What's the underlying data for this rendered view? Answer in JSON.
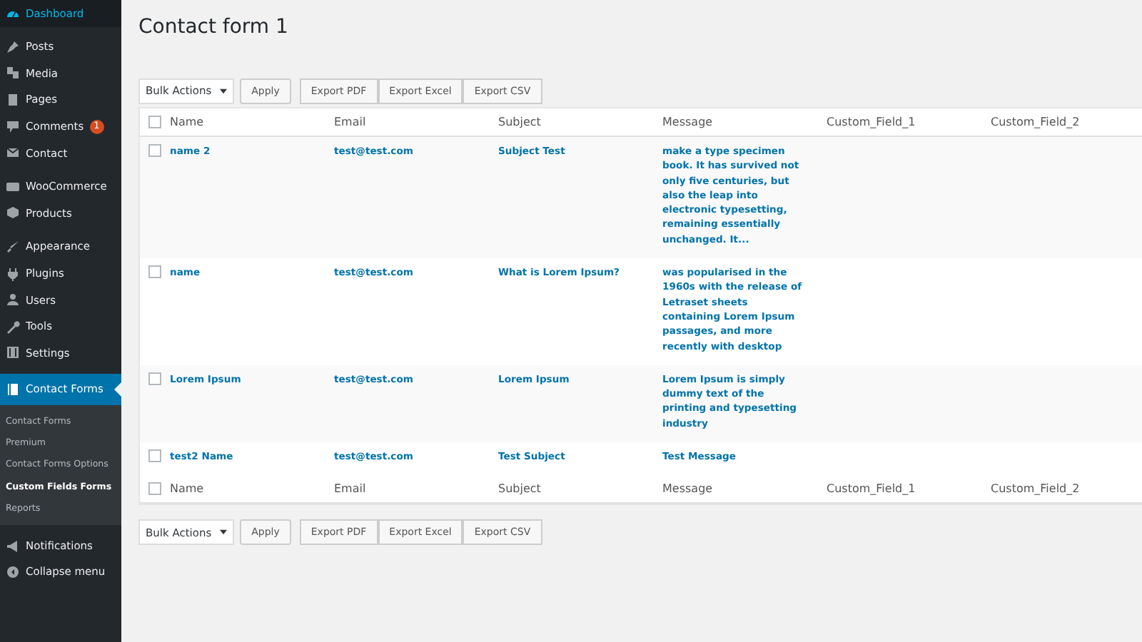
{
  "sidebar": {
    "groups": [
      [
        {
          "label": "Dashboard",
          "selected": false,
          "highlighted": true
        }
      ],
      [
        {
          "label": "Posts",
          "selected": false,
          "highlighted": false
        },
        {
          "label": "Media",
          "selected": false,
          "highlighted": false
        },
        {
          "label": "Pages",
          "selected": false,
          "highlighted": false
        },
        {
          "label": "Comments",
          "selected": false,
          "highlighted": false,
          "badge": "1"
        },
        {
          "label": "Contact",
          "selected": false,
          "highlighted": false
        }
      ],
      [
        {
          "label": "WooCommerce",
          "selected": false,
          "highlighted": false
        },
        {
          "label": "Products",
          "selected": false,
          "highlighted": false
        }
      ],
      [
        {
          "label": "Appearance",
          "selected": false,
          "highlighted": false
        },
        {
          "label": "Plugins",
          "selected": false,
          "highlighted": false
        },
        {
          "label": "Users",
          "selected": false,
          "highlighted": false
        },
        {
          "label": "Tools",
          "selected": false,
          "highlighted": false
        },
        {
          "label": "Settings",
          "selected": false,
          "highlighted": false
        }
      ],
      [
        {
          "label": "Contact Forms",
          "selected": true,
          "highlighted": false,
          "children": [
            {
              "label": "Contact Forms",
              "selected": false
            },
            {
              "label": "Premium",
              "selected": false
            },
            {
              "label": "Contact Forms Options",
              "selected": false
            },
            {
              "label": "Custom Fields Forms",
              "selected": true
            },
            {
              "label": "Reports",
              "selected": false
            }
          ]
        }
      ],
      [
        {
          "label": "Notifications",
          "selected": false,
          "highlighted": false
        },
        {
          "label": "Collapse menu",
          "selected": false,
          "highlighted": false
        }
      ]
    ]
  },
  "page_title": "Contact form 1",
  "top_actions": {
    "bulk_select": "Bulk Actions",
    "buttons": [
      "Apply",
      "Export PDF",
      "Export Excel",
      "Export CSV"
    ]
  },
  "table": {
    "header_checked": false,
    "columns": [
      "Name",
      "Email",
      "Subject",
      "Message",
      "Custom_Field_1",
      "Custom_Field_2"
    ],
    "rows": [
      {
        "checked": false,
        "cells": [
          "name 2",
          "test@test.com",
          "Subject Test",
          "make a type specimen book. It has survived not only five centuries, but also the leap into electronic typesetting, remaining essentially unchanged. It..."
        ]
      },
      {
        "checked": false,
        "cells": [
          "name",
          "test@test.com",
          "What is Lorem Ipsum?",
          "was popularised in the 1960s with the release of Letraset sheets containing Lorem Ipsum passages, and more recently with desktop"
        ]
      },
      {
        "checked": false,
        "cells": [
          "Lorem Ipsum",
          "test@test.com",
          "Lorem Ipsum",
          "Lorem Ipsum is simply dummy text of the printing and typesetting industry"
        ]
      },
      {
        "checked": false,
        "cells": [
          "test2 Name",
          "test@test.com",
          "Test Subject",
          "Test Message"
        ]
      }
    ],
    "footer_checked": false,
    "footer_columns": [
      "Name",
      "Email",
      "Subject",
      "Message",
      "Custom_Field_1",
      "Custom_Field_2"
    ]
  },
  "bottom_actions": {
    "bulk_select": "Bulk Actions",
    "buttons": [
      "Apply",
      "Export PDF",
      "Export Excel",
      "Export CSV"
    ]
  }
}
